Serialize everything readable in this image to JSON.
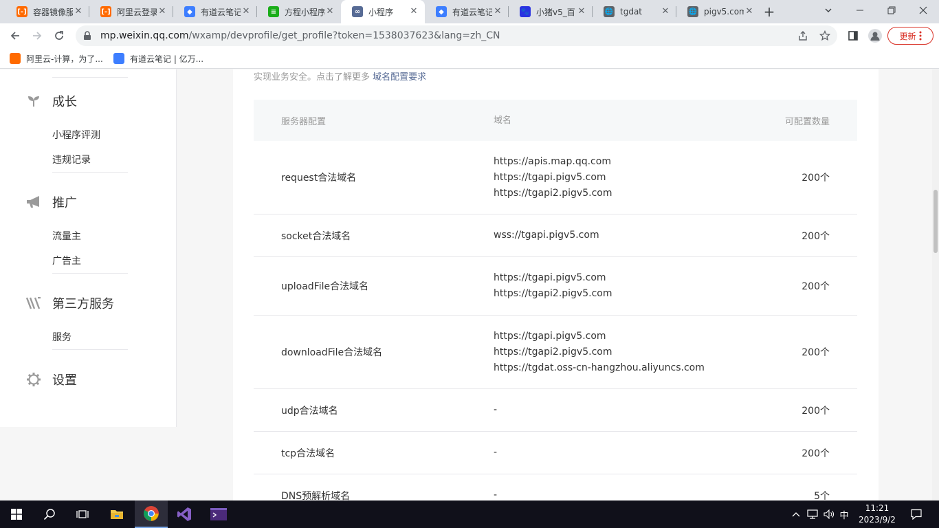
{
  "browser": {
    "tabs": [
      {
        "title": "容器镜像服",
        "favicon_color": "#ff6a00",
        "favicon_glyph": "[-]"
      },
      {
        "title": "阿里云登录",
        "favicon_color": "#ff6a00",
        "favicon_glyph": "[-]"
      },
      {
        "title": "有道云笔记",
        "favicon_color": "#3d7eff",
        "favicon_glyph": "◆"
      },
      {
        "title": "方程小程序",
        "favicon_color": "#1aad19",
        "favicon_glyph": "≡"
      },
      {
        "title": "小程序",
        "favicon_color": "#576b95",
        "favicon_glyph": "∞",
        "active": true
      },
      {
        "title": "有道云笔记",
        "favicon_color": "#3d7eff",
        "favicon_glyph": "◆"
      },
      {
        "title": "小猪v5_百",
        "favicon_color": "#2932e1",
        "favicon_glyph": "🐾"
      },
      {
        "title": "tgdat",
        "favicon_color": "#5f6368",
        "favicon_glyph": "🌐"
      },
      {
        "title": "pigv5.com",
        "favicon_color": "#5f6368",
        "favicon_glyph": "🌐"
      }
    ],
    "url_host": "mp.weixin.qq.com",
    "url_path": "/wxamp/devprofile/get_profile?token=1538037623&lang=zh_CN",
    "update_label": "更新",
    "bookmarks": [
      {
        "label": "阿里云-计算，为了...",
        "favicon_color": "#ff6a00"
      },
      {
        "label": "有道云笔记 | 亿万...",
        "favicon_color": "#3d7eff"
      }
    ]
  },
  "sidebar": {
    "sections": [
      {
        "label": "成长",
        "icon": "sprout-icon",
        "items": [
          "小程序评测",
          "违规记录"
        ]
      },
      {
        "label": "推广",
        "icon": "megaphone-icon",
        "items": [
          "流量主",
          "广告主"
        ]
      },
      {
        "label": "第三方服务",
        "icon": "third-party-icon",
        "items": [
          "服务"
        ]
      },
      {
        "label": "设置",
        "icon": "gear-icon",
        "items": []
      }
    ]
  },
  "main": {
    "notice_text": "实现业务安全。点击了解更多",
    "notice_link": "域名配置要求",
    "table": {
      "headers": [
        "服务器配置",
        "域名",
        "可配置数量"
      ],
      "rows": [
        {
          "name": "request合法域名",
          "domains": [
            "https://apis.map.qq.com",
            "https://tgapi.pigv5.com",
            "https://tgapi2.pigv5.com"
          ],
          "quota": "200个"
        },
        {
          "name": "socket合法域名",
          "domains": [
            "wss://tgapi.pigv5.com"
          ],
          "quota": "200个"
        },
        {
          "name": "uploadFile合法域名",
          "domains": [
            "https://tgapi.pigv5.com",
            "https://tgapi2.pigv5.com"
          ],
          "quota": "200个"
        },
        {
          "name": "downloadFile合法域名",
          "domains": [
            "https://tgapi.pigv5.com",
            "https://tgapi2.pigv5.com",
            "https://tgdat.oss-cn-hangzhou.aliyuncs.com"
          ],
          "quota": "200个"
        },
        {
          "name": "udp合法域名",
          "domains": [
            "-"
          ],
          "quota": "200个"
        },
        {
          "name": "tcp合法域名",
          "domains": [
            "-"
          ],
          "quota": "200个"
        },
        {
          "name": "DNS预解析域名",
          "domains": [
            "-"
          ],
          "quota": "5个"
        }
      ]
    }
  },
  "taskbar": {
    "ime": "中",
    "time": "11:21",
    "date": "2023/9/2"
  }
}
